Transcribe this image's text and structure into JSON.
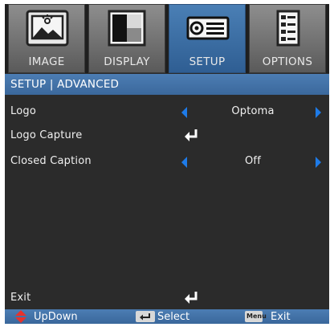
{
  "tabs": [
    {
      "label": "IMAGE",
      "icon": "image-icon",
      "active": false
    },
    {
      "label": "DISPLAY",
      "icon": "display-icon",
      "active": false
    },
    {
      "label": "SETUP",
      "icon": "projector-icon",
      "active": true
    },
    {
      "label": "OPTIONS",
      "icon": "options-icon",
      "active": false
    }
  ],
  "header": {
    "title": "SETUP | ADVANCED"
  },
  "menu": {
    "logo": {
      "label": "Logo",
      "value": "Optoma"
    },
    "logo_capture": {
      "label": "Logo Capture"
    },
    "closed_caption": {
      "label": "Closed Caption",
      "value": "Off"
    },
    "exit": {
      "label": "Exit"
    }
  },
  "footer": {
    "updown_label": "UpDown",
    "select_label": "Select",
    "menu_key": "Menu",
    "exit_label": "Exit"
  },
  "colors": {
    "accent": "#1e7be8",
    "active_tab": "#3a6ea5",
    "background": "#2b2b2b"
  }
}
